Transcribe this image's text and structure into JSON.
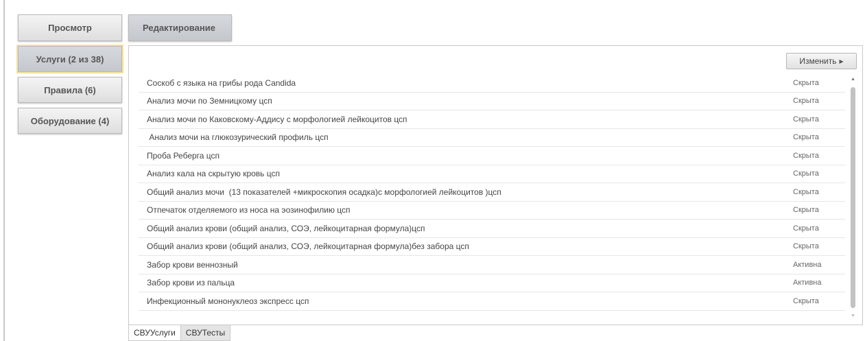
{
  "top_tabs": {
    "view": "Просмотр",
    "edit": "Редактирование"
  },
  "sidebar": {
    "items": [
      {
        "label": "Услуги (2 из 38)"
      },
      {
        "label": "Правила (6)"
      },
      {
        "label": "Оборудование (4)"
      }
    ]
  },
  "panel": {
    "edit_button": "Изменить",
    "rows": [
      {
        "name": "Соскоб с языка на грибы рода Candida",
        "status": "Скрыта"
      },
      {
        "name": "Анализ мочи по Земницкому цсп",
        "status": "Скрыта"
      },
      {
        "name": "Анализ мочи по Каковскому-Аддису с морфологией лейкоцитов цсп",
        "status": "Скрыта"
      },
      {
        "name": " Анализ мочи на глюкозурический профиль цсп",
        "status": "Скрыта"
      },
      {
        "name": "Проба Реберга цсп",
        "status": "Скрыта"
      },
      {
        "name": "Анализ кала на скрытую кровь цсп",
        "status": "Скрыта"
      },
      {
        "name": "Общий анализ мочи  (13 показателей +микроскопия осадка)с морфологией лейкоцитов )цсп",
        "status": "Скрыта"
      },
      {
        "name": "Отпечаток отделяемого из носа на эозинофилию цсп",
        "status": "Скрыта"
      },
      {
        "name": "Общий анализ крови (общий анализ, СОЭ, лейкоцитарная формула)цсп",
        "status": "Скрыта"
      },
      {
        "name": "Общий анализ крови (общий анализ, СОЭ, лейкоцитарная формула)без забора цсп",
        "status": "Скрыта"
      },
      {
        "name": "Забор крови веннозный",
        "status": "Активна"
      },
      {
        "name": "Забор крови из пальца",
        "status": "Активна"
      },
      {
        "name": "Инфекционный мононуклеоз экспресс цсп",
        "status": "Скрыта"
      }
    ]
  },
  "bottom_tabs": [
    {
      "label": "СВУУслуги"
    },
    {
      "label": "СВУТесты"
    }
  ]
}
